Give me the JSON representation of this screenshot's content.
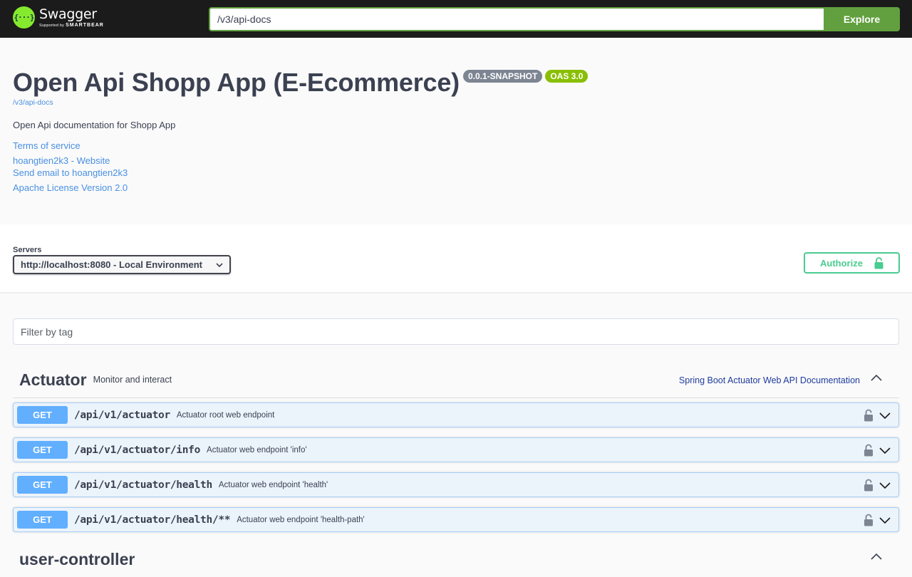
{
  "topbar": {
    "logo_name": "Swagger",
    "logo_sub_prefix": "Supported by",
    "logo_sub_brand": "SMARTBEAR",
    "logo_glyph": "{···}",
    "url_value": "/v3/api-docs",
    "explore_label": "Explore"
  },
  "info": {
    "title": "Open Api Shopp App (E-Ecommerce)",
    "version_badge": "0.0.1-SNAPSHOT",
    "oas_badge": "OAS 3.0",
    "doc_link": "/v3/api-docs",
    "description": "Open Api documentation for Shopp App",
    "terms": "Terms of service",
    "website": "hoangtien2k3 - Website",
    "email": "Send email to hoangtien2k3",
    "license": "Apache License Version 2.0"
  },
  "servers": {
    "label": "Servers",
    "selected": "http://localhost:8080 - Local Environment",
    "authorize_label": "Authorize"
  },
  "filter": {
    "placeholder": "Filter by tag",
    "value": ""
  },
  "tags": [
    {
      "name": "Actuator",
      "description": "Monitor and interact",
      "external_docs": "Spring Boot Actuator Web API Documentation",
      "expanded": true,
      "operations": [
        {
          "method": "GET",
          "path": "/api/v1/actuator",
          "summary": "Actuator root web endpoint"
        },
        {
          "method": "GET",
          "path": "/api/v1/actuator/info",
          "summary": "Actuator web endpoint 'info'"
        },
        {
          "method": "GET",
          "path": "/api/v1/actuator/health",
          "summary": "Actuator web endpoint 'health'"
        },
        {
          "method": "GET",
          "path": "/api/v1/actuator/health/**",
          "summary": "Actuator web endpoint 'health-path'"
        }
      ]
    },
    {
      "name": "user-controller",
      "description": "",
      "expanded": true
    }
  ],
  "colors": {
    "topbar_bg": "#1b1b1b",
    "explore_green": "#62a03f",
    "logo_green": "#85ea2d",
    "link_blue": "#4990e2",
    "get_blue": "#61affe",
    "authorize_green": "#49cc90",
    "version_badge_gray": "#7d8492",
    "oas_badge_green": "#89bf04"
  }
}
